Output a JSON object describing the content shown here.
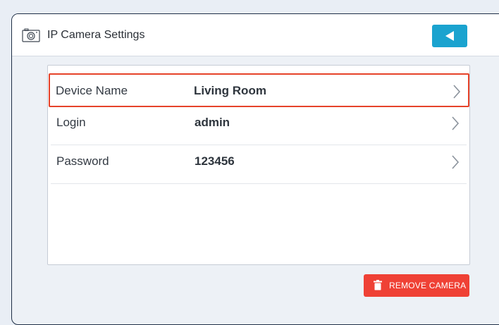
{
  "header": {
    "title": "IP Camera Settings",
    "camera_icon": "camera-icon",
    "back_icon": "back-arrow-icon"
  },
  "settings": [
    {
      "label": "Device Name",
      "value": "Living Room",
      "selected": true
    },
    {
      "label": "Login",
      "value": "admin",
      "selected": false
    },
    {
      "label": "Password",
      "value": "123456",
      "selected": false
    }
  ],
  "footer": {
    "remove_label": "REMOVE CAMERA",
    "remove_icon": "trash-icon"
  },
  "colors": {
    "accent": "#1aa3cf",
    "danger": "#ef4135",
    "selection_outline": "#e6432a"
  }
}
